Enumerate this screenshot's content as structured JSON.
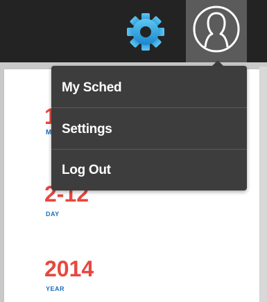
{
  "header": {
    "settings_icon": "gear-icon",
    "profile_icon": "user-avatar-icon",
    "accent_gear_color": "#2a9fd8"
  },
  "dropdown": {
    "items": [
      {
        "label": "My Sched"
      },
      {
        "label": "Settings"
      },
      {
        "label": "Log Out"
      }
    ]
  },
  "date": {
    "month_value": "1",
    "month_label": "M",
    "day_value": "2-12",
    "day_label": "DAY",
    "year_value": "2014",
    "year_label": "YEAR"
  },
  "colors": {
    "date_red": "#e8473e",
    "label_blue": "#1b6fb8",
    "menu_bg": "#3d3d3d"
  }
}
